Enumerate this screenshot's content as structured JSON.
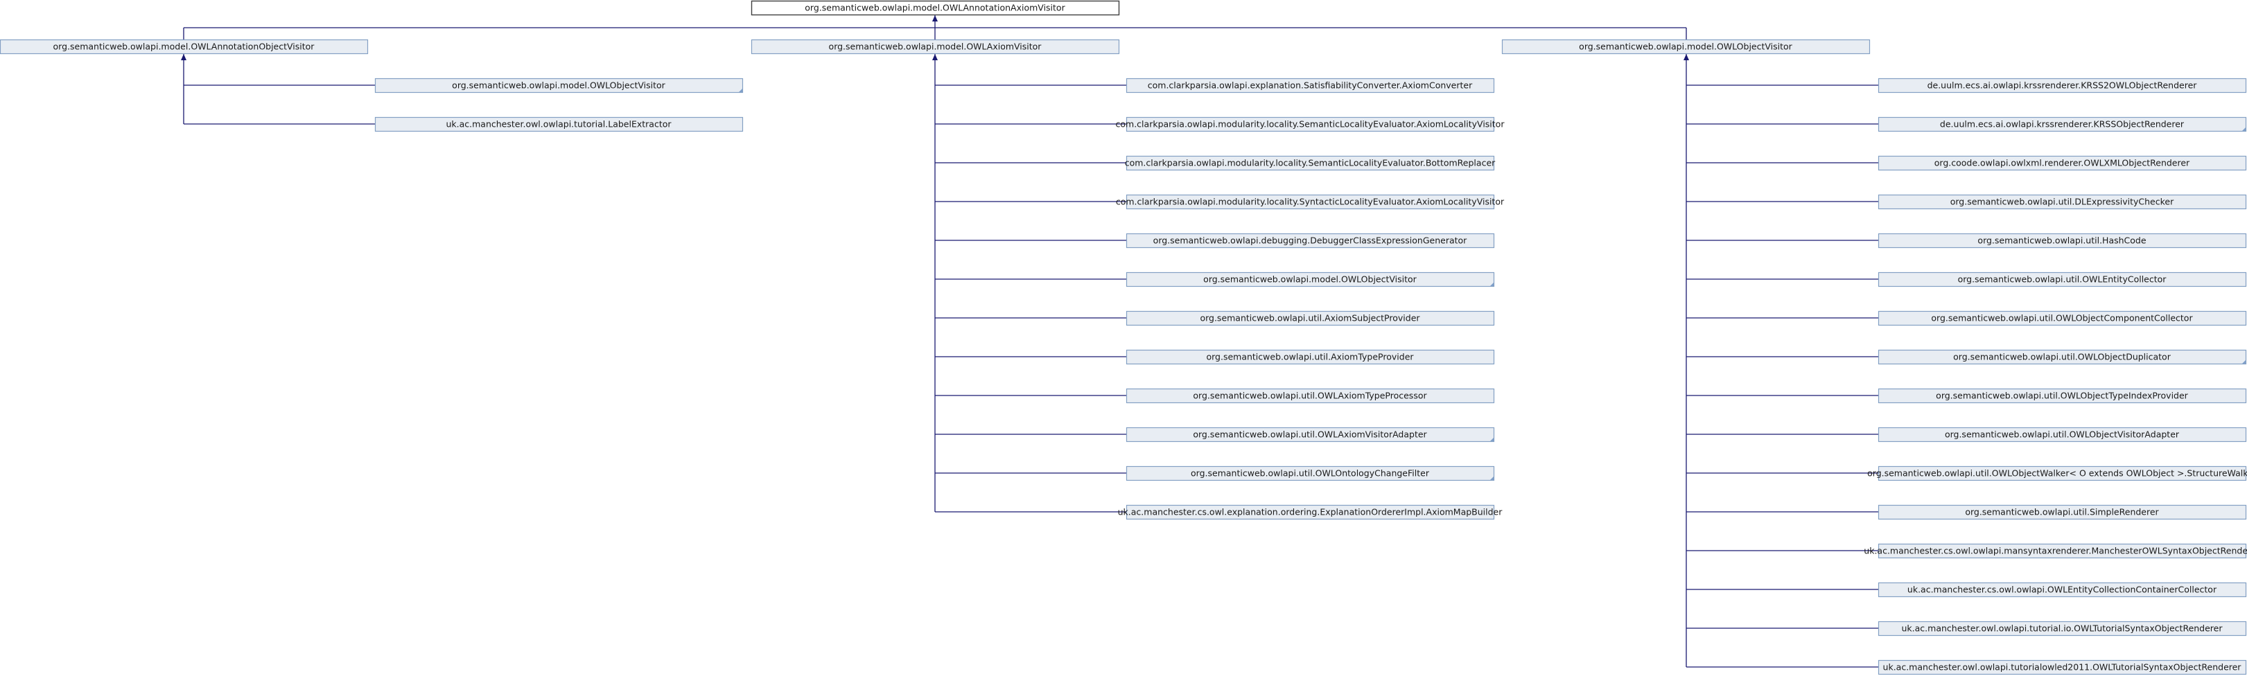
{
  "root": "org.semanticweb.owlapi.model.OWLAnnotationAxiomVisitor",
  "branches": [
    {
      "key": "ann",
      "parent": "org.semanticweb.owlapi.model.OWLAnnotationObjectVisitor",
      "children": [
        {
          "label": "org.semanticweb.owlapi.model.OWLObjectVisitor",
          "truncated": true
        },
        {
          "label": "uk.ac.manchester.owl.owlapi.tutorial.LabelExtractor",
          "truncated": false
        }
      ]
    },
    {
      "key": "axiom",
      "parent": "org.semanticweb.owlapi.model.OWLAxiomVisitor",
      "children": [
        {
          "label": "com.clarkparsia.owlapi.explanation.SatisfiabilityConverter.AxiomConverter",
          "truncated": false
        },
        {
          "label": "com.clarkparsia.owlapi.modularity.locality.SemanticLocalityEvaluator.AxiomLocalityVisitor",
          "truncated": false
        },
        {
          "label": "com.clarkparsia.owlapi.modularity.locality.SemanticLocalityEvaluator.BottomReplacer",
          "truncated": false
        },
        {
          "label": "com.clarkparsia.owlapi.modularity.locality.SyntacticLocalityEvaluator.AxiomLocalityVisitor",
          "truncated": false
        },
        {
          "label": "org.semanticweb.owlapi.debugging.DebuggerClassExpressionGenerator",
          "truncated": false
        },
        {
          "label": "org.semanticweb.owlapi.model.OWLObjectVisitor",
          "truncated": true
        },
        {
          "label": "org.semanticweb.owlapi.util.AxiomSubjectProvider",
          "truncated": false
        },
        {
          "label": "org.semanticweb.owlapi.util.AxiomTypeProvider",
          "truncated": false
        },
        {
          "label": "org.semanticweb.owlapi.util.OWLAxiomTypeProcessor",
          "truncated": false
        },
        {
          "label": "org.semanticweb.owlapi.util.OWLAxiomVisitorAdapter",
          "truncated": true
        },
        {
          "label": "org.semanticweb.owlapi.util.OWLOntologyChangeFilter",
          "truncated": true
        },
        {
          "label": "uk.ac.manchester.cs.owl.explanation.ordering.ExplanationOrdererImpl.AxiomMapBuilder",
          "truncated": false
        }
      ]
    },
    {
      "key": "object",
      "parent": "org.semanticweb.owlapi.model.OWLObjectVisitor",
      "children": [
        {
          "label": "de.uulm.ecs.ai.owlapi.krssrenderer.KRSS2OWLObjectRenderer",
          "truncated": false
        },
        {
          "label": "de.uulm.ecs.ai.owlapi.krssrenderer.KRSSObjectRenderer",
          "truncated": true
        },
        {
          "label": "org.coode.owlapi.owlxml.renderer.OWLXMLObjectRenderer",
          "truncated": false
        },
        {
          "label": "org.semanticweb.owlapi.util.DLExpressivityChecker",
          "truncated": false
        },
        {
          "label": "org.semanticweb.owlapi.util.HashCode",
          "truncated": false
        },
        {
          "label": "org.semanticweb.owlapi.util.OWLEntityCollector",
          "truncated": false
        },
        {
          "label": "org.semanticweb.owlapi.util.OWLObjectComponentCollector",
          "truncated": false
        },
        {
          "label": "org.semanticweb.owlapi.util.OWLObjectDuplicator",
          "truncated": true
        },
        {
          "label": "org.semanticweb.owlapi.util.OWLObjectTypeIndexProvider",
          "truncated": false
        },
        {
          "label": "org.semanticweb.owlapi.util.OWLObjectVisitorAdapter",
          "truncated": false
        },
        {
          "label": "org.semanticweb.owlapi.util.OWLObjectWalker< O extends OWLObject >.StructureWalker",
          "truncated": false
        },
        {
          "label": "org.semanticweb.owlapi.util.SimpleRenderer",
          "truncated": false
        },
        {
          "label": "uk.ac.manchester.cs.owl.owlapi.mansyntaxrenderer.ManchesterOWLSyntaxObjectRenderer",
          "truncated": false
        },
        {
          "label": "uk.ac.manchester.cs.owl.owlapi.OWLEntityCollectionContainerCollector",
          "truncated": false
        },
        {
          "label": "uk.ac.manchester.owl.owlapi.tutorial.io.OWLTutorialSyntaxObjectRenderer",
          "truncated": false
        },
        {
          "label": "uk.ac.manchester.owl.owlapi.tutorialowled2011.OWLTutorialSyntaxObjectRenderer",
          "truncated": false
        }
      ]
    }
  ],
  "colors": {
    "node_fill": "#e8edf3",
    "node_border": "#84a0c4",
    "root_border": "#404040",
    "edge": "#191970"
  }
}
